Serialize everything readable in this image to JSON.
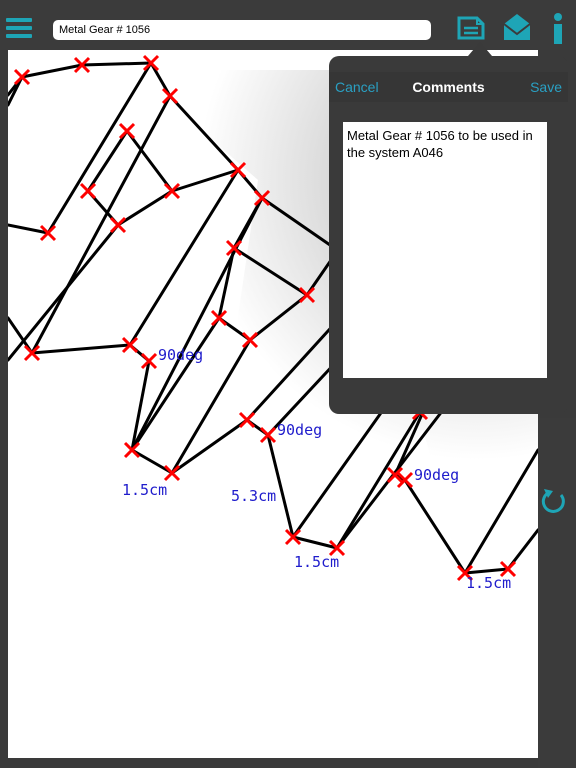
{
  "toolbar": {
    "menu_icon": "hamburger-menu-icon",
    "title_value": "Metal Gear # 1056",
    "icons": [
      "notes-icon",
      "mail-icon",
      "info-icon"
    ],
    "accent_color": "#1ea5b6"
  },
  "comments_popup": {
    "cancel_label": "Cancel",
    "title": "Comments",
    "save_label": "Save",
    "text": "Metal Gear # 1056 to be used in the system A046"
  },
  "drawing": {
    "line_color": "#000000",
    "marker_color": "#ff0000",
    "label_color": "#1f1ccc",
    "measurements": [
      "90deg",
      "90deg",
      "90deg",
      "1.5cm",
      "5.3cm",
      "1.5cm",
      "1.5cm"
    ]
  },
  "side_panel": {
    "reset_icon": "rotate-reset-icon"
  }
}
